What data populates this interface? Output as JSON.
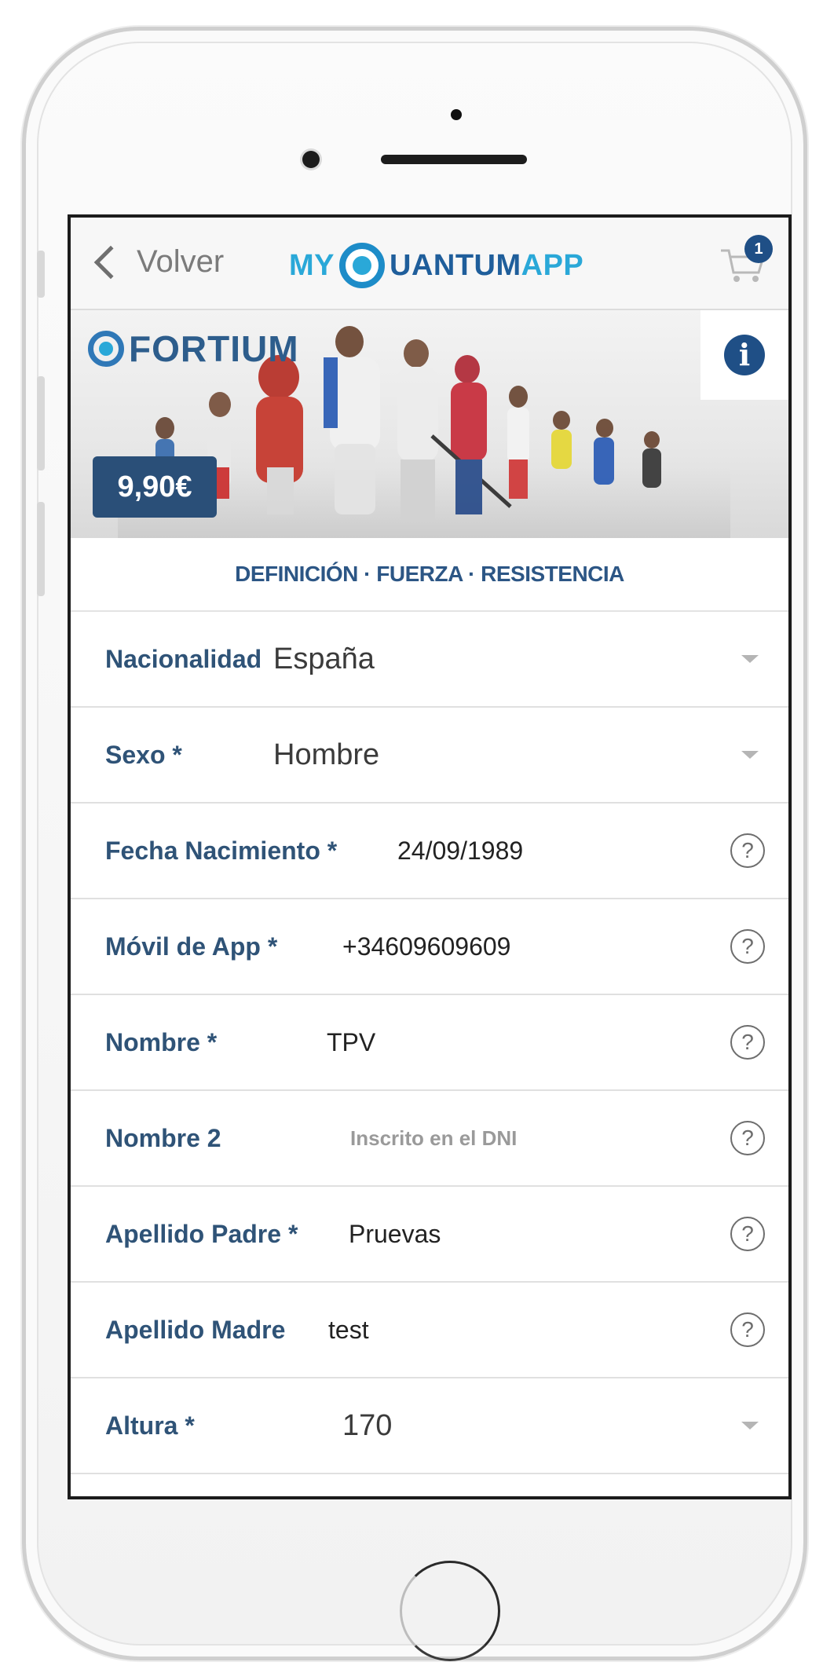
{
  "nav": {
    "back_label": "Volver",
    "brand": {
      "my": "MY",
      "uantum": "UANTUM",
      "app": "APP"
    },
    "cart_count": "1"
  },
  "banner": {
    "logo_text": "FORTIUM",
    "price": "9,90€",
    "info_icon": "info-icon",
    "tagline": "DEFINICIÓN · FUERZA · RESISTENCIA"
  },
  "form": {
    "rows": [
      {
        "label": "Nacionalidad",
        "value": "España",
        "control": "select"
      },
      {
        "label": "Sexo *",
        "value": "Hombre",
        "control": "select"
      },
      {
        "label": "Fecha Nacimiento *",
        "value": "24/09/1989",
        "control": "help"
      },
      {
        "label": "Móvil de App *",
        "value": "+34609609609",
        "control": "help"
      },
      {
        "label": "Nombre *",
        "value": "TPV",
        "control": "help"
      },
      {
        "label": "Nombre 2",
        "placeholder": "Inscrito en el DNI",
        "control": "help"
      },
      {
        "label": "Apellido Padre *",
        "value": "Pruevas",
        "control": "help"
      },
      {
        "label": "Apellido Madre",
        "value": "test",
        "control": "help"
      },
      {
        "label": "Altura *",
        "value": "170",
        "control": "select"
      }
    ],
    "help_glyph": "?"
  },
  "colors": {
    "brand_dark": "#1f4f86",
    "brand_light": "#2aa8d8",
    "label": "#2f5377"
  }
}
